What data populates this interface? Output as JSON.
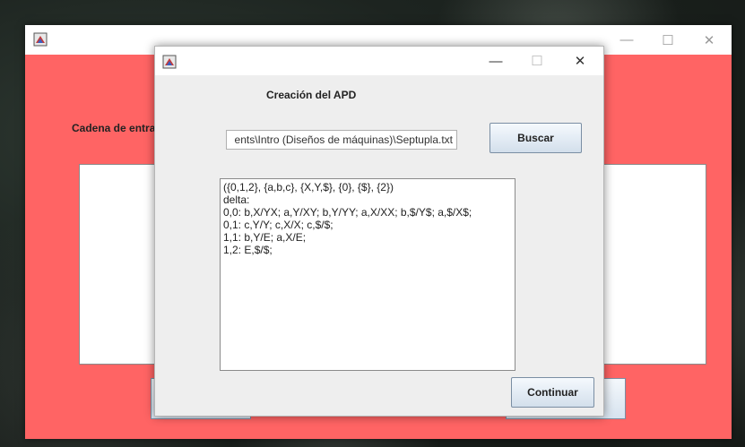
{
  "back_window": {
    "label": "Cadena de entra",
    "controls": {
      "minimize": "—",
      "maximize": "☐",
      "close": "✕"
    }
  },
  "dialog": {
    "controls": {
      "minimize": "—",
      "maximize": "☐",
      "close": "✕"
    },
    "heading": "Creación del APD",
    "path_value": "ents\\Intro (Diseños de máquinas)\\Septupla.txt",
    "buscar_label": "Buscar",
    "output_lines": [
      "({0,1,2}, {a,b,c}, {X,Y,$}, {0}, {$}, {2})",
      "delta:",
      "0,0: b,X/YX; a,Y/XY; b,Y/YY; a,X/XX; b,$/Y$; a,$/X$;",
      "0,1: c,Y/Y; c,X/X; c,$/$;",
      "1,1: b,Y/E; a,X/E;",
      "1,2: E,$/$;"
    ],
    "continuar_label": "Continuar"
  },
  "colors": {
    "back_window_bg": "#ff6464",
    "dialog_bg": "#eeeeee",
    "button_border": "#7a8ea3"
  },
  "icons": [
    "java-app-icon",
    "minimize-icon",
    "maximize-icon",
    "close-icon"
  ]
}
